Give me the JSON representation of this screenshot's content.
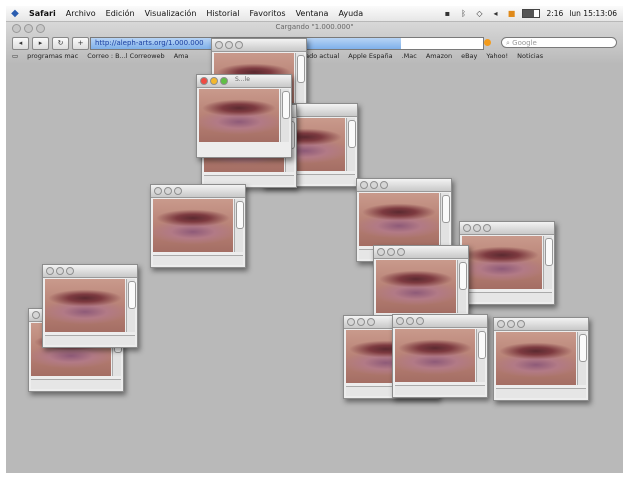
{
  "menubar": {
    "apple": "",
    "items": [
      "Safari",
      "Archivo",
      "Edición",
      "Visualización",
      "Historial",
      "Favoritos",
      "Ventana",
      "Ayuda"
    ],
    "clock": "lun 15:13:06",
    "battery_text": "2:16"
  },
  "browser": {
    "window_title": "Cargando \"1.000.000\"",
    "url": "http://aleph-arts.org/1.000.000",
    "search_placeholder": "Google",
    "load_progress": 0.79,
    "bookmarks": [
      "programas mac",
      "Correo : B...l Correoweb",
      "Ama",
      "desbloqueado actual",
      "Apple España",
      ".Mac",
      "Amazon",
      "eBay",
      "Yahoo!",
      "Noticias"
    ]
  },
  "popups": {
    "active_title": "S...le",
    "count": 15
  }
}
